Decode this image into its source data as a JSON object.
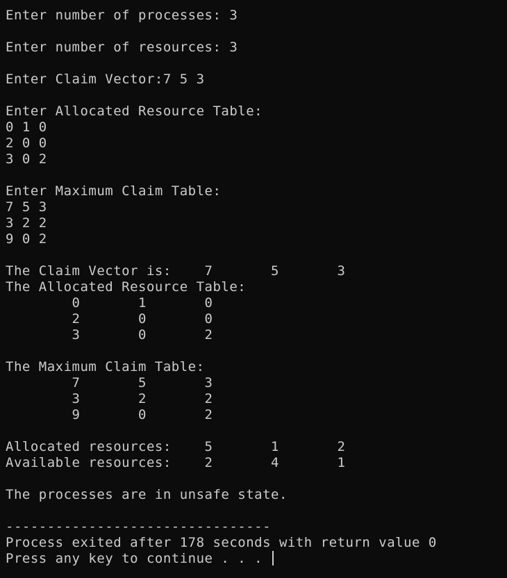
{
  "console": {
    "lines": [
      "Enter number of processes: 3",
      "",
      "Enter number of resources: 3",
      "",
      "Enter Claim Vector:7 5 3",
      "",
      "Enter Allocated Resource Table:",
      "0 1 0",
      "2 0 0",
      "3 0 2",
      "",
      "Enter Maximum Claim Table:",
      "7 5 3",
      "3 2 2",
      "9 0 2",
      "",
      "The Claim Vector is:    7       5       3",
      "The Allocated Resource Table:",
      "        0       1       0",
      "        2       0       0",
      "        3       0       2",
      "",
      "The Maximum Claim Table:",
      "        7       5       3",
      "        3       2       2",
      "        9       0       2",
      "",
      "Allocated resources:    5       1       2",
      "Available resources:    2       4       1",
      "",
      "The processes are in unsafe state.",
      "",
      "--------------------------------",
      "Process exited after 178 seconds with return value 0",
      "Press any key to continue . . . "
    ]
  },
  "colors": {
    "background": "#0c0c0c",
    "foreground": "#cccccc"
  }
}
